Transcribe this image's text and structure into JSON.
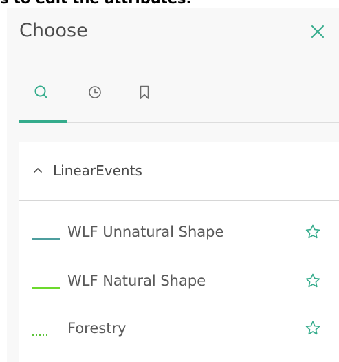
{
  "caption": "s to edit the attributes.",
  "panel": {
    "title": "Choose"
  },
  "tabs": [
    {
      "name": "search",
      "icon": "search-icon",
      "active": true
    },
    {
      "name": "recent",
      "icon": "clock-icon",
      "active": false
    },
    {
      "name": "favorites",
      "icon": "bookmark-icon",
      "active": false
    }
  ],
  "group": {
    "label": "LinearEvents",
    "expanded": true,
    "icon": "chevron-up-icon"
  },
  "items": [
    {
      "label": "WLF Unnatural Shape",
      "color": "#4e9e9e",
      "line_style": "solid",
      "favorite_icon": "star-outline-icon"
    },
    {
      "label": "WLF Natural Shape",
      "color": "#6cd92d",
      "line_style": "solid",
      "favorite_icon": "star-outline-icon"
    },
    {
      "label": "Forestry",
      "color": "#5cc43a",
      "line_style": "dotted",
      "favorite_icon": "star-outline-icon"
    }
  ],
  "colors": {
    "accent": "#35ac8c",
    "panel_bg": "#f8f8f8",
    "list_bg": "#ffffff",
    "text": "#4c4c4c"
  }
}
